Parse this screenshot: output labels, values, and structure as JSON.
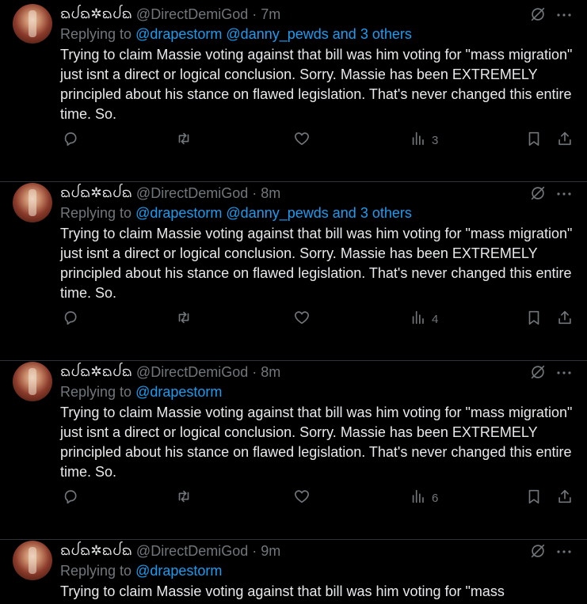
{
  "tweets": [
    {
      "display_name": "ᨳᨸᨳ✲ᨳᨸᨳ",
      "handle": "@DirectDemiGod",
      "sep": "·",
      "time": "7m",
      "reply_prefix": "Replying to",
      "mentions": [
        "@drapestorm",
        "@danny_pewds"
      ],
      "others": "and 3 others",
      "text": "Trying to claim Massie voting against that bill was him voting for \"mass migration\" just isnt a direct or logical conclusion. Sorry. Massie has been EXTREMELY principled about his stance on flawed legislation. That's never changed this entire time. So.",
      "views": "3"
    },
    {
      "display_name": "ᨳᨸᨳ✲ᨳᨸᨳ",
      "handle": "@DirectDemiGod",
      "sep": "·",
      "time": "8m",
      "reply_prefix": "Replying to",
      "mentions": [
        "@drapestorm",
        "@danny_pewds"
      ],
      "others": "and 3 others",
      "text": "Trying to claim Massie voting against that bill was him voting for \"mass migration\" just isnt a direct or logical conclusion. Sorry. Massie has been EXTREMELY principled about his stance on flawed legislation. That's never changed this entire time. So.",
      "views": "4"
    },
    {
      "display_name": "ᨳᨸᨳ✲ᨳᨸᨳ",
      "handle": "@DirectDemiGod",
      "sep": "·",
      "time": "8m",
      "reply_prefix": "Replying to",
      "mentions": [
        "@drapestorm"
      ],
      "others": "",
      "text": "Trying to claim Massie voting against that bill was him voting for \"mass migration\" just isnt a direct or logical conclusion. Sorry. Massie has been EXTREMELY principled about his stance on flawed legislation. That's never changed this entire time. So.",
      "views": "6"
    },
    {
      "display_name": "ᨳᨸᨳ✲ᨳᨸᨳ",
      "handle": "@DirectDemiGod",
      "sep": "·",
      "time": "9m",
      "reply_prefix": "Replying to",
      "mentions": [
        "@drapestorm"
      ],
      "others": "",
      "text": "Trying to claim Massie voting against that bill was him voting for \"mass",
      "views": ""
    }
  ],
  "icons": {
    "reply": "reply-icon",
    "retweet": "retweet-icon",
    "like": "heart-icon",
    "views": "views-icon",
    "bookmark": "bookmark-icon",
    "share": "share-icon",
    "grok": "grok-icon",
    "more": "more-icon"
  },
  "colors": {
    "background": "#000000",
    "text": "#e7e9ea",
    "muted": "#71767b",
    "link": "#1d9bf0",
    "divider": "#2f3336"
  }
}
